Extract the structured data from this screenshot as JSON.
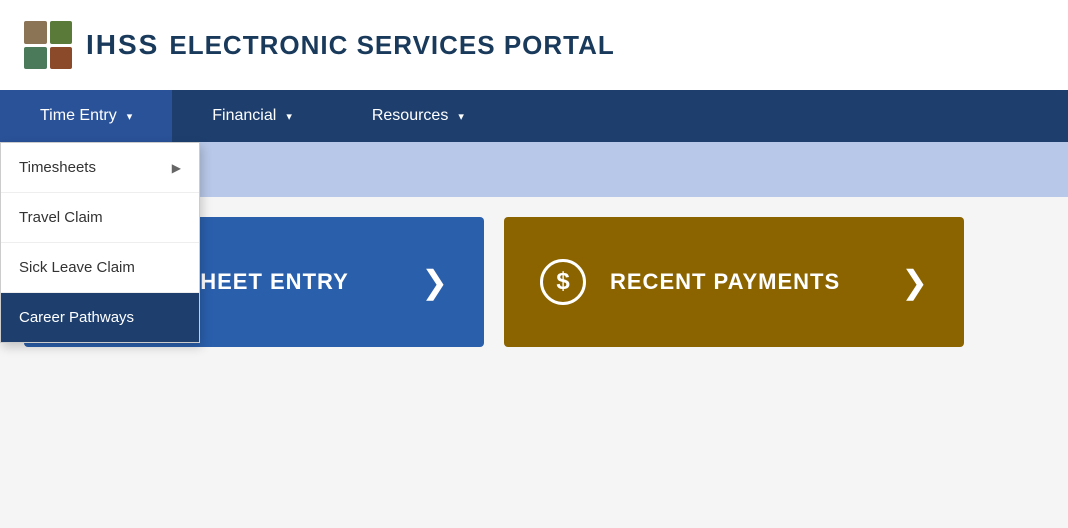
{
  "header": {
    "brand_ihss": "IHSS",
    "brand_subtitle": "ELECTRONIC SERVICES PORTAL"
  },
  "logo": {
    "colors": [
      "#8B7355",
      "#5A7A3A",
      "#4A7A5A",
      "#8B4A2A"
    ]
  },
  "navbar": {
    "items": [
      {
        "label": "Time Entry",
        "has_arrow": true,
        "active": true
      },
      {
        "label": "Financial",
        "has_arrow": true,
        "active": false
      },
      {
        "label": "Resources",
        "has_arrow": true,
        "active": false
      }
    ]
  },
  "dropdown": {
    "items": [
      {
        "label": "Timesheets",
        "has_submenu": true,
        "highlighted": false
      },
      {
        "label": "Travel Claim",
        "has_submenu": false,
        "highlighted": false
      },
      {
        "label": "Sick Leave Claim",
        "has_submenu": false,
        "highlighted": false
      },
      {
        "label": "Career Pathways",
        "has_submenu": false,
        "highlighted": true
      }
    ]
  },
  "cards": [
    {
      "label": "TIMESHEET ENTRY",
      "type": "timesheet",
      "color": "#2a5fac"
    },
    {
      "label": "RECENT PAYMENTS",
      "type": "payments",
      "color": "#8B6400"
    }
  ],
  "icons": {
    "chevron_right": "❯",
    "dollar_sign": "$",
    "submenu_arrow": "▶"
  }
}
